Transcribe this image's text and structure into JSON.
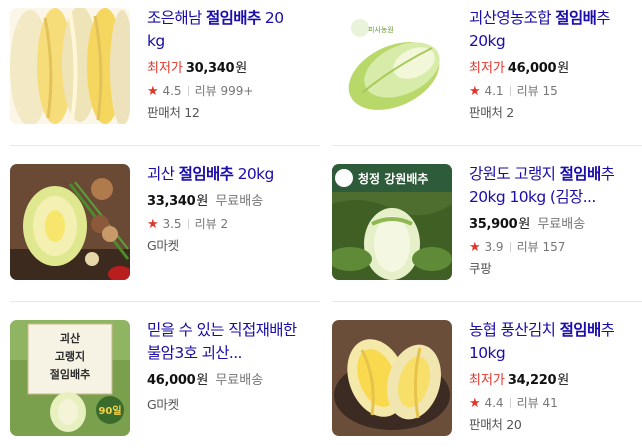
{
  "products": [
    {
      "title_pre": "조은해남 ",
      "title_hl": "절임배추",
      "title_post": " 20 kg",
      "price_label": "최저가",
      "price": "30,340",
      "currency": "원",
      "shipping": "",
      "star": "★",
      "rating": "4.5",
      "reviews": "리뷰 999+",
      "seller": "판매처 12"
    },
    {
      "title_pre": "괴산영농조합 ",
      "title_hl": "절임배",
      "title_post": "추 20kg",
      "price_label": "최저가",
      "price": "46,000",
      "currency": "원",
      "shipping": "",
      "star": "★",
      "rating": "4.1",
      "reviews": "리뷰 15",
      "seller": "판매처 2",
      "thumb_logo": "피사농원"
    },
    {
      "title_pre": "괴산 ",
      "title_hl": "절임배추",
      "title_post": " 20kg",
      "price_label": "",
      "price": "33,340",
      "currency": "원",
      "shipping": "무료배송",
      "star": "★",
      "rating": "3.5",
      "reviews": "리뷰 2",
      "seller": "G마켓"
    },
    {
      "title_pre": "강원도 고랭지 ",
      "title_hl": "절임배",
      "title_post": "추 20kg 10kg (김장...",
      "price_label": "",
      "price": "35,900",
      "currency": "원",
      "shipping": "무료배송",
      "star": "★",
      "rating": "3.9",
      "reviews": "리뷰 157",
      "seller": "쿠팡",
      "thumb_banner": "청정 강원배추"
    },
    {
      "title_pre": "믿을 수 있는 직접재배한 불암3호 괴산...",
      "title_hl": "",
      "title_post": "",
      "price_label": "",
      "price": "46,000",
      "currency": "원",
      "shipping": "무료배송",
      "star": "",
      "rating": "",
      "reviews": "",
      "seller": "G마켓",
      "thumb_sign": [
        "괴산",
        "고랭지",
        "절임배추"
      ],
      "thumb_badge": "90일"
    },
    {
      "title_pre": "농협 풍산김치 ",
      "title_hl": "절임배",
      "title_post": "추 10kg",
      "price_label": "최저가",
      "price": "34,220",
      "currency": "원",
      "shipping": "",
      "star": "★",
      "rating": "4.4",
      "reviews": "리뷰 41",
      "seller": "판매처 20"
    }
  ],
  "colors": {
    "link": "#1a0dab",
    "accent": "#e0362c",
    "muted": "#767676"
  }
}
